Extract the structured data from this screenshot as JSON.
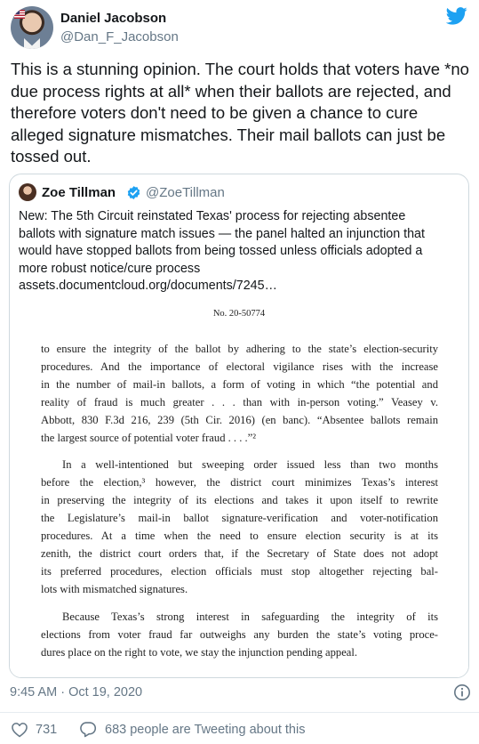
{
  "author": {
    "name": "Daniel Jacobson",
    "handle": "@Dan_F_Jacobson"
  },
  "tweet": {
    "text": "This is a stunning opinion.  The court holds that voters have *no due process rights at all* when their ballots are rejected, and therefore voters don't need to be given a chance to cure alleged signature mismatches. Their mail ballots can just be tossed out.",
    "timestamp": "9:45 AM · Oct 19, 2020"
  },
  "quoted_tweet": {
    "name": "Zoe Tillman",
    "handle": "@ZoeTillman",
    "verified": true,
    "text_lines": [
      "New: The 5th Circuit reinstated Texas' process for rejecting absentee",
      "ballots with signature match issues — the panel halted an injunction that",
      "would have stopped ballots from being tossed unless officials adopted a",
      "more robust notice/cure process",
      "assets.documentcloud.org/documents/7245…"
    ],
    "document": {
      "number": "No. 20-50774",
      "paragraph_1": [
        "to ensure the integrity of the ballot by adhering to the state’s election-security",
        "procedures.  And the importance of electoral vigilance rises with the increase",
        "in the number of mail-in ballots, a form of voting in which “the potential and",
        "reality of fraud is much greater . . . than with in-person voting.”  Veasey v.",
        "Abbott, 830 F.3d 216, 239 (5th Cir. 2016) (en banc).  “Absentee ballots remain",
        "the largest source of potential voter fraud . . . .”²"
      ],
      "paragraph_2": [
        "In a well-intentioned but sweeping order issued less than two months",
        "before the election,³ however, the district court minimizes Texas’s interest",
        "in preserving the integrity of its elections and takes it upon itself to rewrite",
        "the Legislature’s mail-in ballot signature-verification and voter-notification",
        "procedures.  At a time when the need to ensure election security is at its",
        "zenith, the district court orders that, if the Secretary of State does not adopt",
        "its preferred procedures, election officials must stop altogether rejecting bal-",
        "lots with mismatched signatures."
      ],
      "paragraph_3": [
        "Because Texas’s strong interest in safeguarding the integrity of its",
        "elections from voter fraud far outweighs any burden the state’s voting proce-",
        "dures place on the right to vote, we stay the injunction pending appeal."
      ]
    }
  },
  "engagement": {
    "likes": "731",
    "tweeting": "683 people are Tweeting about this"
  },
  "icons": {
    "brand": "twitter-bird-icon",
    "verified": "verified-badge-icon",
    "info": "info-icon",
    "like": "heart-icon",
    "reply": "speech-bubble-icon"
  },
  "colors": {
    "twitter_blue": "#1da1f2",
    "secondary_text": "#657786",
    "border": "#cfd9de"
  }
}
